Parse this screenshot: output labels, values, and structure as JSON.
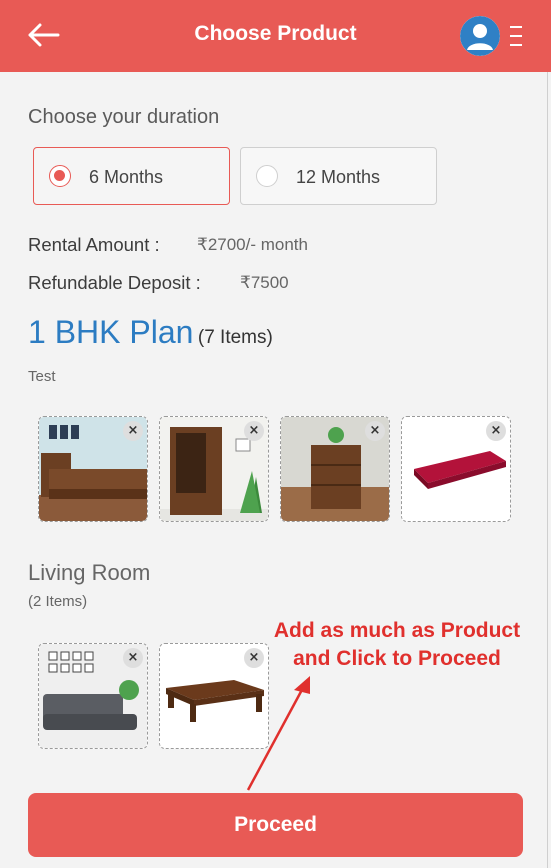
{
  "header": {
    "title": "Choose Product",
    "back_icon": "back-arrow-icon",
    "avatar_icon": "user-avatar-icon",
    "menu_icon": "menu-icon"
  },
  "duration": {
    "title": "Choose your duration",
    "options": [
      {
        "label": "6 Months",
        "selected": true
      },
      {
        "label": "12 Months",
        "selected": false
      }
    ]
  },
  "pricing": {
    "rental_label": "Rental Amount :",
    "rental_value": "₹2700/- month",
    "deposit_label": "Refundable Deposit :",
    "deposit_value": "₹7500"
  },
  "plan": {
    "name": "1 BHK Plan",
    "items": "(7 Items)",
    "subtitle": "Test"
  },
  "bedroom_products": [
    {
      "name": "Wooden Bed",
      "remove": "×"
    },
    {
      "name": "Wardrobe",
      "remove": "×"
    },
    {
      "name": "Side Table",
      "remove": "×"
    },
    {
      "name": "Mattress",
      "remove": "×"
    }
  ],
  "living_room": {
    "title": "Living Room",
    "count": "(2 Items)",
    "products": [
      {
        "name": "Sofa",
        "remove": "×"
      },
      {
        "name": "Coffee Table",
        "remove": "×"
      }
    ]
  },
  "annotation": {
    "line1": "Add as much as Product",
    "line2": "and Click to Proceed"
  },
  "footer": {
    "proceed_label": "Proceed"
  },
  "colors": {
    "accent": "#e85a55",
    "plan_blue": "#2c7cc2",
    "annotation_red": "#e0302d"
  }
}
